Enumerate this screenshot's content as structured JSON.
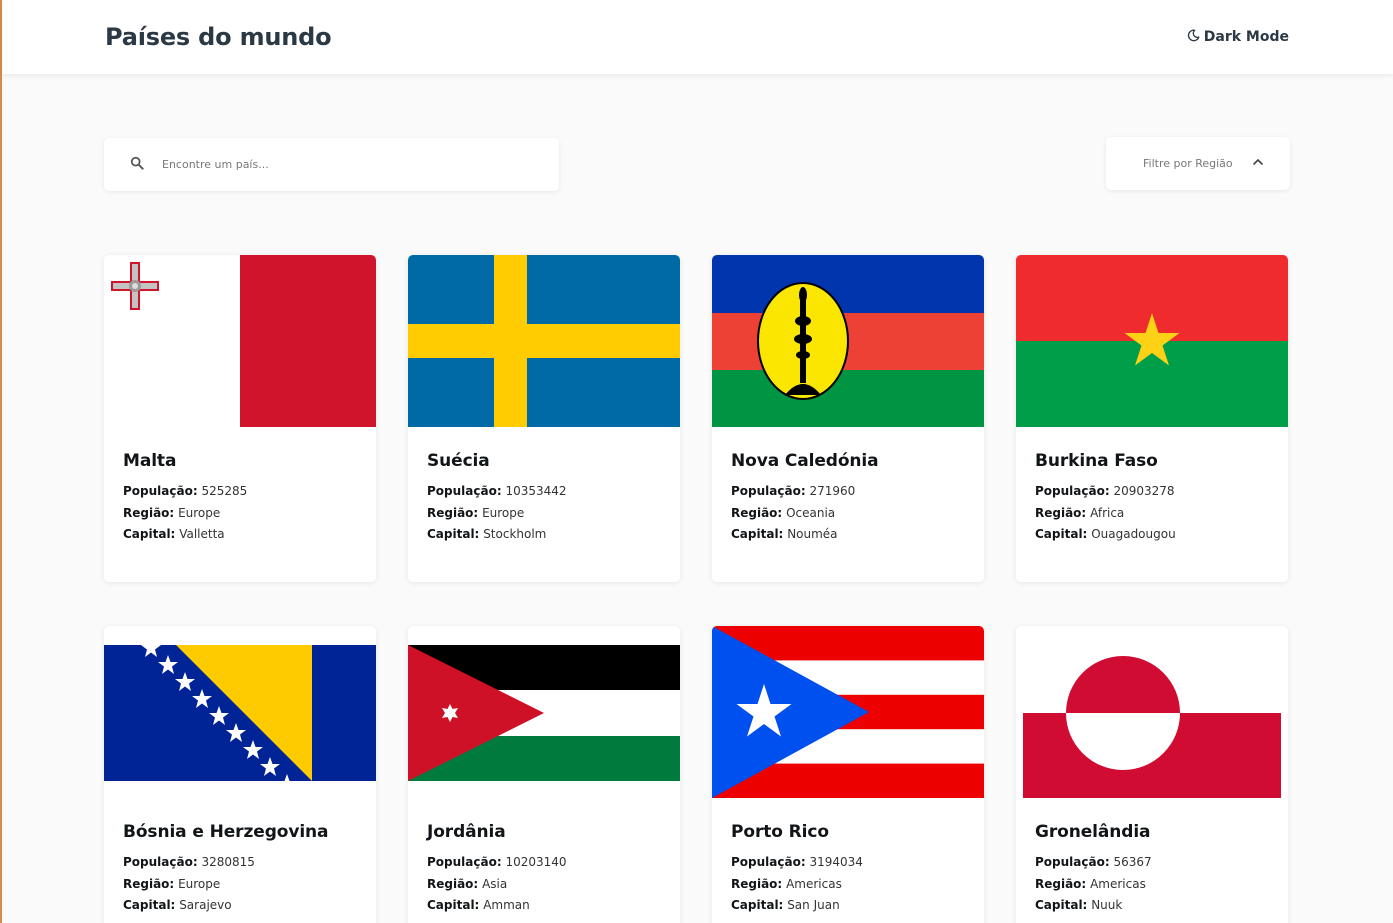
{
  "header": {
    "title": "Países do mundo",
    "dark_mode_label": "Dark Mode"
  },
  "search": {
    "placeholder": "Encontre um país..."
  },
  "filter": {
    "label": "Filtre por Região"
  },
  "labels": {
    "population": "População:",
    "region": "Região:",
    "capital": "Capital:"
  },
  "countries": [
    {
      "name": "Malta",
      "population": "525285",
      "region": "Europe",
      "capital": "Valletta"
    },
    {
      "name": "Suécia",
      "population": "10353442",
      "region": "Europe",
      "capital": "Stockholm"
    },
    {
      "name": "Nova Caledónia",
      "population": "271960",
      "region": "Oceania",
      "capital": "Nouméa"
    },
    {
      "name": "Burkina Faso",
      "population": "20903278",
      "region": "Africa",
      "capital": "Ouagadougou"
    },
    {
      "name": "Bósnia e Herzegovina",
      "population": "3280815",
      "region": "Europe",
      "capital": "Sarajevo"
    },
    {
      "name": "Jordânia",
      "population": "10203140",
      "region": "Asia",
      "capital": "Amman"
    },
    {
      "name": "Porto Rico",
      "population": "3194034",
      "region": "Americas",
      "capital": "San Juan"
    },
    {
      "name": "Gronelândia",
      "population": "56367",
      "region": "Americas",
      "capital": "Nuuk"
    }
  ],
  "colors": {
    "text": "#111517",
    "header_text": "#2b3945",
    "background": "#fafafa",
    "card": "#ffffff"
  }
}
